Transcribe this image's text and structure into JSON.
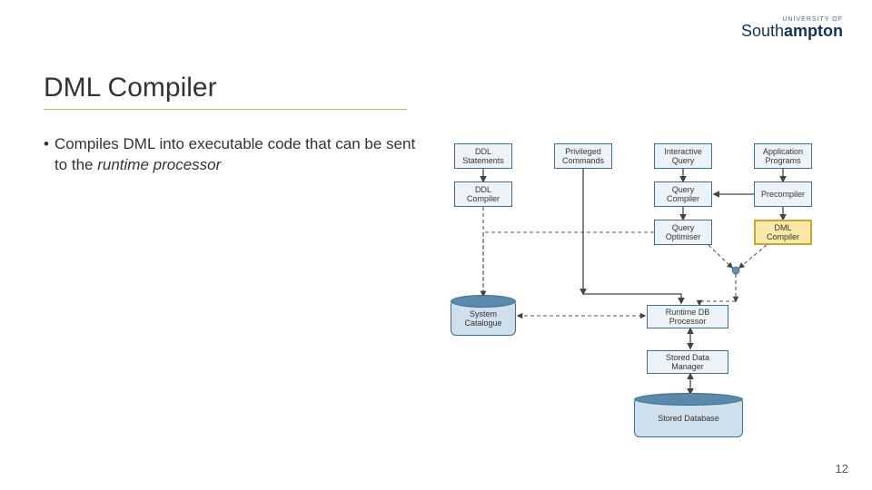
{
  "logo": {
    "top": "UNIVERSITY OF",
    "name_plain": "South",
    "name_bold": "ampton"
  },
  "title": "DML Compiler",
  "bullet": {
    "marker": "•",
    "text_a": "Compiles DML into executable code that can be sent to the ",
    "text_em": "runtime processor"
  },
  "page": "12",
  "boxes": {
    "ddl_stm": "DDL Statements",
    "priv_cmd": "Privileged Commands",
    "int_qry": "Interactive Query",
    "app_prog": "Application Programs",
    "ddl_comp": "DDL Compiler",
    "qry_comp": "Query Compiler",
    "precomp": "Precompiler",
    "qry_opt": "Query Optimiser",
    "dml_comp": "DML Compiler",
    "runtime": "Runtime DB Processor",
    "sdman": "Stored Data Manager"
  },
  "cyl": {
    "syscat": "System Catalogue",
    "db": "Stored Database"
  }
}
